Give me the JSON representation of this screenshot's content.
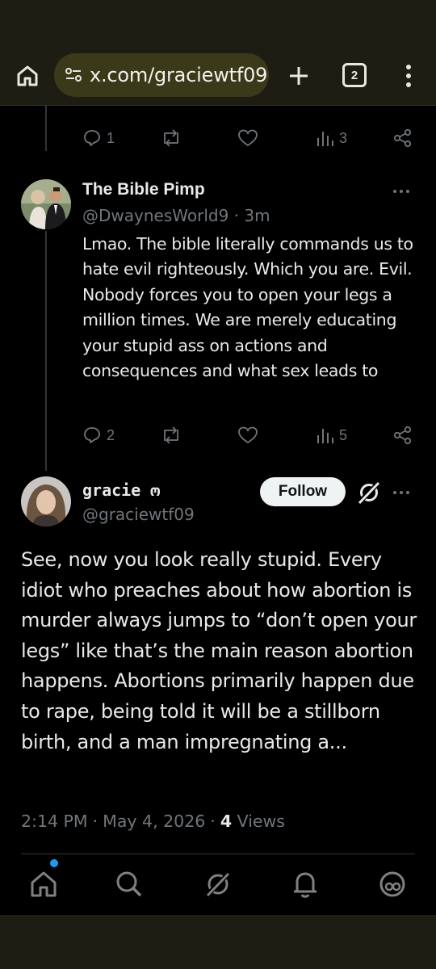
{
  "browser": {
    "url": "x.com/graciewtf09",
    "tab_count": "2",
    "icons": [
      "home-icon",
      "site-settings-icon",
      "plus-icon",
      "tabs-icon",
      "menu-icon"
    ]
  },
  "prev_tweet": {
    "reply_count": "1",
    "views": "3"
  },
  "reply": {
    "name": "The Bible Pimp",
    "handle": "@DwaynesWorld9 · 3m",
    "text": "Lmao. The bible literally commands us to hate evil righteously. Which you are. Evil. Nobody forces you to open your legs a million times. We are merely educating your stupid ass on actions and consequences and what sex leads to",
    "reply_count": "2",
    "views": "5"
  },
  "main_tweet": {
    "name": "gracie ო",
    "handle": "@graciewtf09",
    "follow_label": "Follow",
    "text": "See, now you look really stupid. Every idiot who preaches about how abortion is murder always jumps to “don’t open your legs” like that’s the main reason abortion happens. Abortions primarily happen due to rape, being told it will be a stillborn birth, and a man impregnating a...",
    "time": "2:14 PM",
    "date": "May 4, 2026",
    "views_count": "4",
    "views_label": "Views"
  },
  "nav": {
    "items": [
      "home-icon",
      "search-icon",
      "grok-icon",
      "notifications-icon",
      "communities-icon"
    ]
  },
  "colors": {
    "background": "#000000",
    "browser_chrome": "#1e1d14",
    "url_box": "#3a3a1a",
    "text": "#e7e9ea",
    "muted": "#71767b",
    "accent": "#1d9bf0"
  }
}
